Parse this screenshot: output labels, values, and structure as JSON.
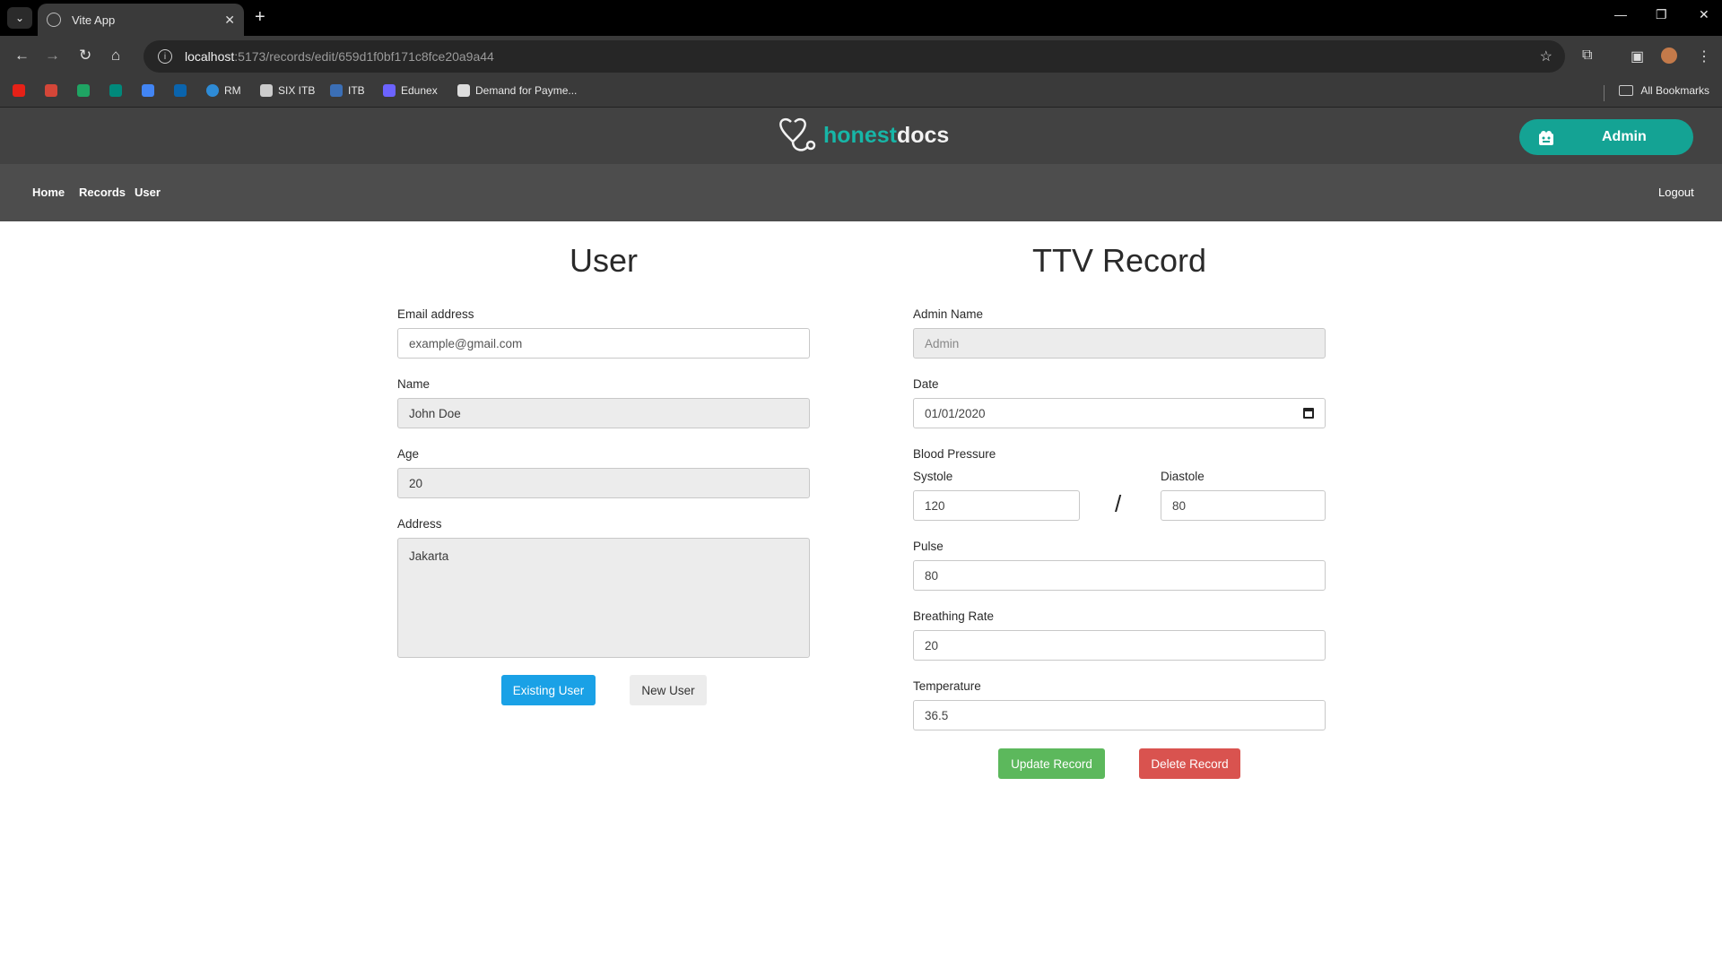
{
  "browser": {
    "tab_title": "Vite App",
    "url_host": "localhost",
    "url_rest": ":5173/records/edit/659d1f0bf171c8fce20a9a44",
    "bookmarks": [
      "RM",
      "SIX ITB",
      "ITB",
      "Edunex",
      "Demand for Payme..."
    ],
    "all_bookmarks": "All Bookmarks"
  },
  "app": {
    "logo_honest": "honest",
    "logo_docs": "docs",
    "account_label": "Admin",
    "nav": [
      "Home",
      "Records",
      "User"
    ],
    "logout": "Logout"
  },
  "user_panel": {
    "title": "User",
    "email_label": "Email address",
    "email_placeholder": "example@gmail.com",
    "name_label": "Name",
    "name_value": "John Doe",
    "age_label": "Age",
    "age_value": "20",
    "address_label": "Address",
    "address_value": "Jakarta",
    "existing_user_button": "Existing User",
    "new_user_button": "New User"
  },
  "record_panel": {
    "title": "TTV Record",
    "admin_label": "Admin Name",
    "admin_value": "Admin",
    "date_label": "Date",
    "date_value": "01/01/2020",
    "bp_label": "Blood Pressure",
    "systole_label": "Systole",
    "systole_value": "120",
    "slash": "/",
    "diastole_label": "Diastole",
    "diastole_value": "80",
    "pulse_label": "Pulse",
    "pulse_value": "80",
    "breathing_label": "Breathing Rate",
    "breathing_value": "20",
    "temperature_label": "Temperature",
    "temperature_value": "36.5",
    "update_button": "Update Record",
    "delete_button": "Delete Record"
  },
  "colors": {
    "brand_teal": "#17b6a7",
    "header_bg": "#424242",
    "nav_bg": "#4d4d4d",
    "primary_blue": "#1aa1e6",
    "success_green": "#5cb85c",
    "danger_red": "#d9534f"
  }
}
